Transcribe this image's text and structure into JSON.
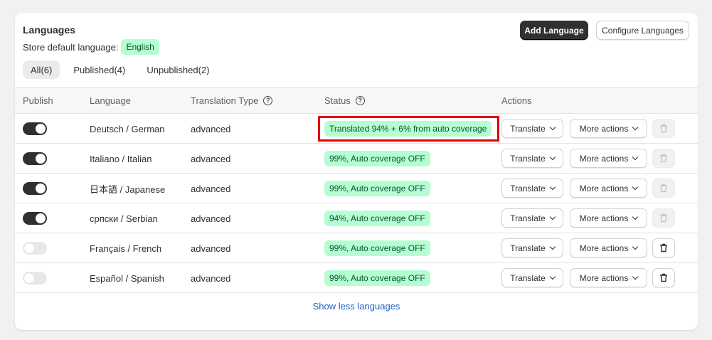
{
  "header": {
    "title": "Languages",
    "default_label": "Store default language:",
    "default_value": "English",
    "add_button": "Add Language",
    "configure_button": "Configure Languages"
  },
  "tabs": [
    {
      "label": "All(6)",
      "active": true
    },
    {
      "label": "Published(4)",
      "active": false
    },
    {
      "label": "Unpublished(2)",
      "active": false
    }
  ],
  "columns": {
    "publish": "Publish",
    "language": "Language",
    "translation_type": "Translation Type",
    "status": "Status",
    "actions": "Actions"
  },
  "rows": [
    {
      "published": true,
      "language": "Deutsch / German",
      "type": "advanced",
      "status": "Translated 94% + 6% from auto coverage",
      "trash_enabled": false
    },
    {
      "published": true,
      "language": "Italiano / Italian",
      "type": "advanced",
      "status": "99%, Auto coverage OFF",
      "trash_enabled": false
    },
    {
      "published": true,
      "language": "日本語 / Japanese",
      "type": "advanced",
      "status": "99%, Auto coverage OFF",
      "trash_enabled": false
    },
    {
      "published": true,
      "language": "српски / Serbian",
      "type": "advanced",
      "status": "94%, Auto coverage OFF",
      "trash_enabled": false
    },
    {
      "published": false,
      "language": "Français / French",
      "type": "advanced",
      "status": "99%, Auto coverage OFF",
      "trash_enabled": true
    },
    {
      "published": false,
      "language": "Español / Spanish",
      "type": "advanced",
      "status": "99%, Auto coverage OFF",
      "trash_enabled": true
    }
  ],
  "actions": {
    "translate": "Translate",
    "more": "More actions"
  },
  "footer": {
    "show_less": "Show less languages"
  },
  "colors": {
    "accent_badge": "#b4fed2",
    "highlight_border": "#e00000",
    "link": "#2463bc"
  }
}
